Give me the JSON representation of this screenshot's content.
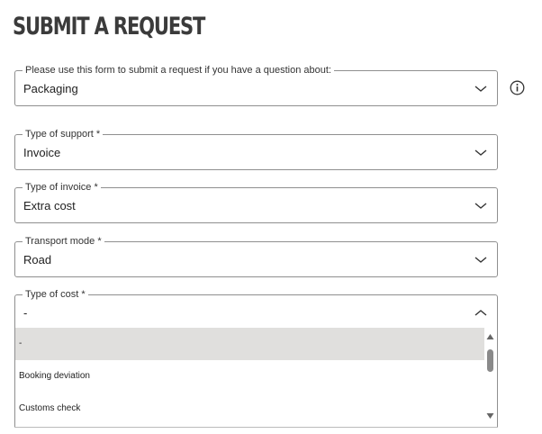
{
  "page": {
    "title": "SUBMIT A REQUEST"
  },
  "fields": [
    {
      "label": "Please use this form to submit a request if you have a question about:",
      "value": "Packaging",
      "icon": "chevron-down-icon"
    },
    {
      "label": "Type of support",
      "required_mark": "*",
      "value": "Invoice",
      "icon": "chevron-down-icon"
    },
    {
      "label": "Type of invoice",
      "required_mark": "*",
      "value": "Extra cost",
      "icon": "chevron-down-icon"
    },
    {
      "label": "Transport mode",
      "required_mark": "*",
      "value": "Road",
      "icon": "chevron-down-icon"
    },
    {
      "label": "Type of cost",
      "required_mark": "*",
      "value": "-",
      "icon": "chevron-up-icon"
    }
  ],
  "dropdown": {
    "options": [
      "-",
      "Booking deviation",
      "Customs check"
    ],
    "selected_index": 0
  },
  "info_icon": "info-icon"
}
